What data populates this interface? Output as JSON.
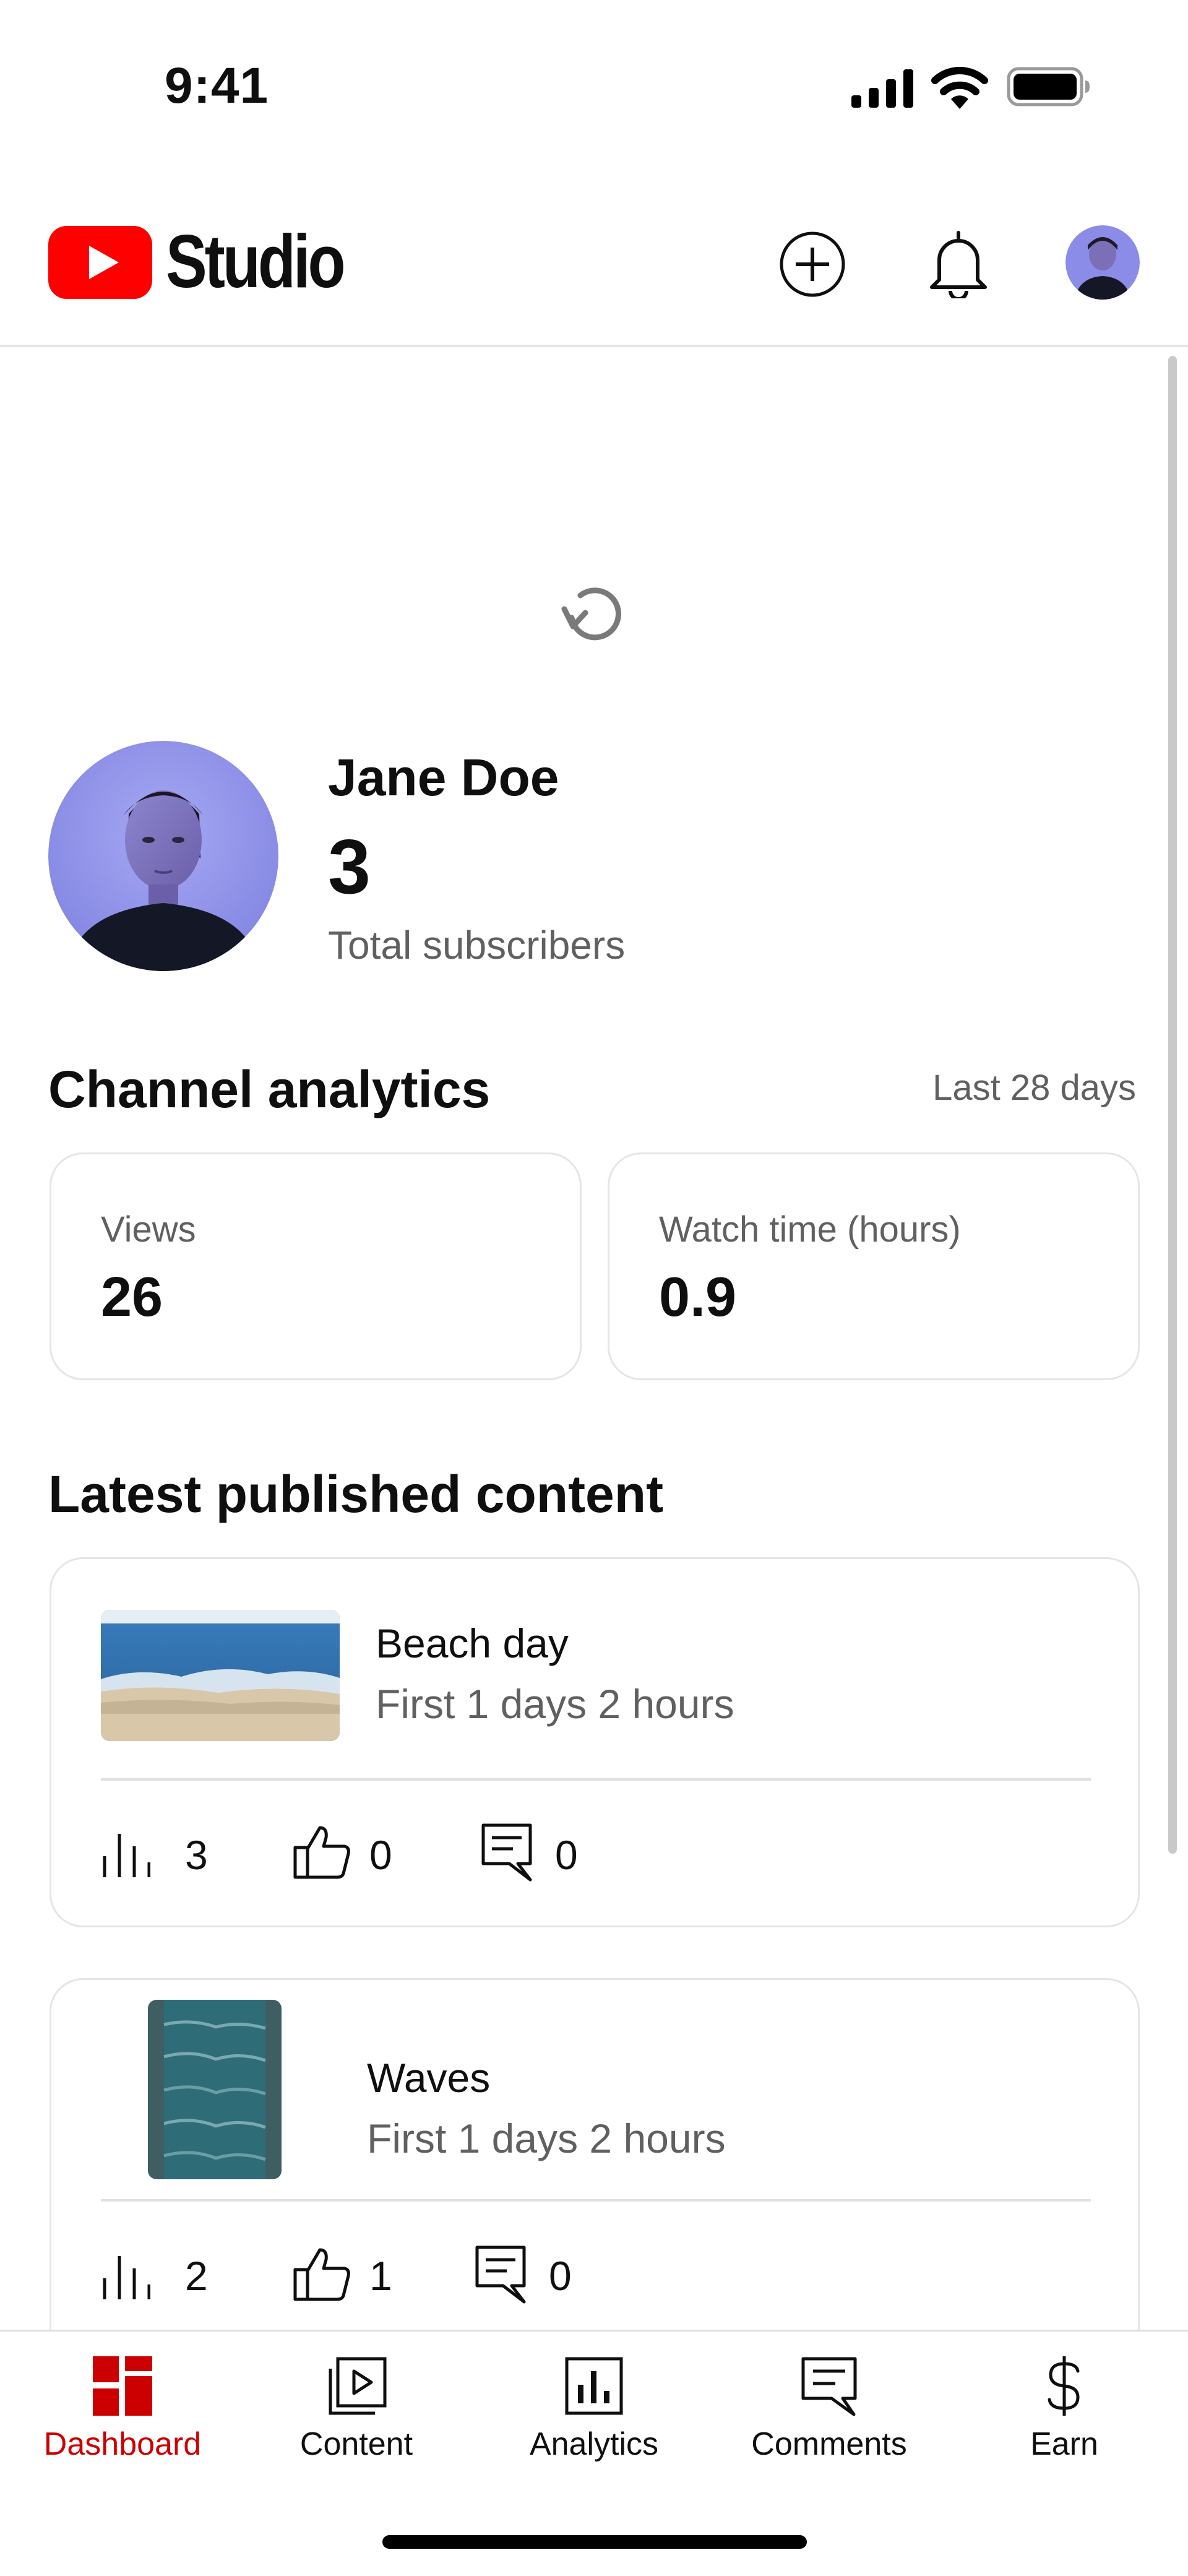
{
  "status_bar": {
    "time": "9:41",
    "icons": [
      "cellular-signal-icon",
      "wifi-icon",
      "battery-icon"
    ]
  },
  "header": {
    "brand": "Studio",
    "logo_icon": "youtube-play-logo",
    "actions": [
      "create-plus-icon",
      "notifications-bell-icon",
      "account-avatar"
    ],
    "logo_color": "#ff0000"
  },
  "channel": {
    "name": "Jane Doe",
    "subscribers": "3",
    "subscribers_label": "Total subscribers"
  },
  "analytics": {
    "title": "Channel analytics",
    "range": "Last 28 days",
    "metrics": [
      {
        "label": "Views",
        "value": "26"
      },
      {
        "label": "Watch time (hours)",
        "value": "0.9"
      }
    ]
  },
  "latest": {
    "title": "Latest published content",
    "items": [
      {
        "title": "Beach day",
        "age": "First 1 days 2 hours",
        "views": "3",
        "likes": "0",
        "comments": "0"
      },
      {
        "title": "Waves",
        "age": "First 1 days 2 hours",
        "views": "2",
        "likes": "1",
        "comments": "0"
      }
    ]
  },
  "nav": {
    "active_color": "#cc0000",
    "items": [
      {
        "label": "Dashboard",
        "icon": "dashboard-icon",
        "active": true
      },
      {
        "label": "Content",
        "icon": "content-icon",
        "active": false
      },
      {
        "label": "Analytics",
        "icon": "analytics-icon",
        "active": false
      },
      {
        "label": "Comments",
        "icon": "comments-icon",
        "active": false
      },
      {
        "label": "Earn",
        "icon": "dollar-icon",
        "active": false
      }
    ]
  }
}
